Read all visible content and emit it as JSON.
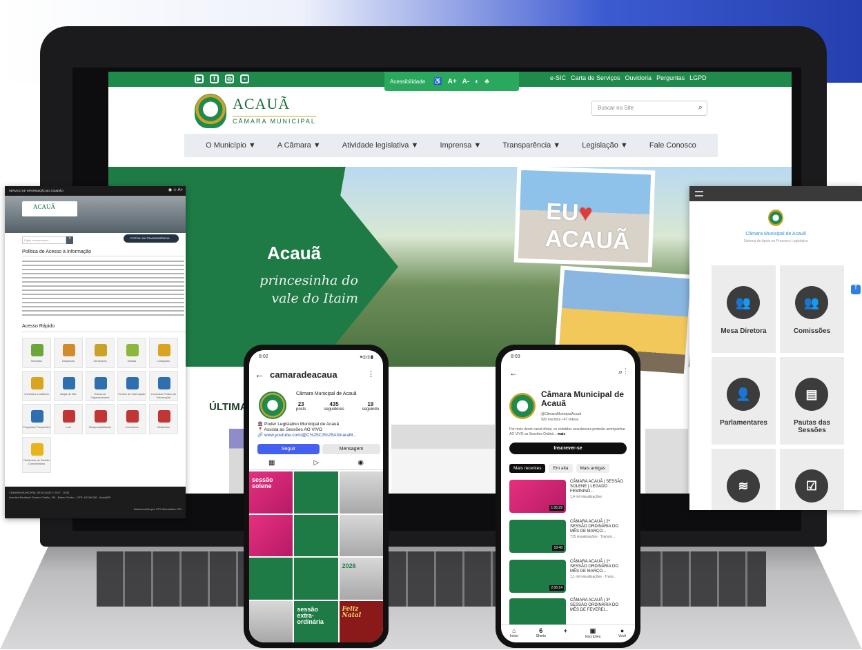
{
  "site": {
    "social": [
      "▶",
      "f",
      "◎",
      "▪"
    ],
    "accessibility_label": "Acessibilidade",
    "accessibility_icons": [
      "♿",
      "A+",
      "A-",
      "◐",
      "♣"
    ],
    "top_links": [
      "e-SIC",
      "Carta de Serviços",
      "Ouvidoria",
      "Perguntas",
      "LGPD"
    ],
    "logo_name": "ACAUÃ",
    "logo_sub": "CÂMARA MUNICIPAL",
    "search_placeholder": "Buscar no Site",
    "nav": [
      "O Município ▼",
      "A Câmara ▼",
      "Atividade legislativa ▼",
      "Imprensa ▼",
      "Transparência ▼",
      "Legislação ▼",
      "Fale Conosco"
    ],
    "hero_title": "Acauã",
    "hero_tagline_1": "princesinha do",
    "hero_tagline_2": "vale do Itaim",
    "hero_photo_text_1": "EU",
    "hero_photo_text_2": "♥",
    "hero_photo_text_3": "ACAUÃ",
    "section_title": "ÚLTIMA"
  },
  "left_portal": {
    "top_bar": "SERVIÇO DE INFORMAÇÃO AO CIDADÃO",
    "top_icons": "◉ ☆ A+",
    "logo": "ACAUÃ",
    "search_placeholder": "Digite sua pesquisa...",
    "portal_badge": "PORTAL DA TRANSPARÊNCIA",
    "heading": "Política de Acesso à Informação",
    "quick_access": "Acesso Rápido",
    "tiles": [
      "Receitas",
      "Despesas",
      "Servidores",
      "Diárias",
      "Licitações",
      "Contratos e Aditivos",
      "Mapa do Site",
      "Estrutura Organizacional",
      "Pedido de Informação",
      "Consultar Pedido de Informação",
      "Perguntas Frequentes",
      "Leis",
      "Responsabilidade",
      "Convênios",
      "Relatórios",
      "Relatórios de Gestão Consolidados"
    ],
    "footer_1": "CÂMARA MUNICIPAL DE ACAUÃ © 2017 - 2026",
    "footer_2": "Avenida Bonifácio Severo Coelho, 2M - Bairro Centro - CEP: 64748-000 - Acauã/PI",
    "footer_3": "Desenvolvido por STS Informática LTD"
  },
  "right_app": {
    "title": "Câmara Municipal de Acauã",
    "subtitle": "Sistema de Apoio ao Processo Legislativo",
    "cards": [
      "Mesa Diretora",
      "Comissões",
      "Parlamentares",
      "Pautas das Sessões",
      "",
      ""
    ],
    "badge": "T"
  },
  "instagram": {
    "time": "8:02",
    "status_icons": "▾◎◎▮",
    "username": "camaradeacaua",
    "display_name": "Câmara Municipal de Acauã",
    "posts": "23",
    "posts_label": "posts",
    "followers": "435",
    "followers_label": "seguidores",
    "following": "19",
    "following_label": "seguindo",
    "bio_1": "🏛 Poder Legislativo Municipal de Acauã",
    "bio_2": "📍 Assista as Sessões AO VIVO",
    "bio_link": "🔗 www.youtube.com/@C%25C3%25A3maraM...",
    "follow_btn": "Seguir",
    "message_btn": "Mensagem",
    "tabs": [
      "▦",
      "▷",
      "◉"
    ],
    "grid_labels": [
      "sessão solene",
      "",
      "",
      "",
      "",
      "",
      "",
      "",
      "2026",
      "",
      "sessão extra-ordinária",
      "Feliz Natal"
    ]
  },
  "youtube": {
    "time": "8:03",
    "channel": "Câmara Municipal de Acauã",
    "handle": "@CâmaraMunicipalAcauã",
    "meta": "920 inscritos • 47 vídeos",
    "desc_1": "Por meio deste canal oficial, os cidadãos acauãenses",
    "desc_2": "poderão acompanhar AO VIVO as Sessões Ordiná...",
    "desc_more": "mais",
    "subscribe": "Inscrever-se",
    "chips": [
      "Mais recentes",
      "Em alta",
      "Mais antigas"
    ],
    "videos": [
      {
        "title": "CÂMARA ACAUÃ | SESSÃO SOLENE | LEGADO FEMININO...",
        "views": "1,4 mil visualizações",
        "dur": "1:05:29"
      },
      {
        "title": "CÂMARA ACAUÃ | 2ª SESSÃO ORDINÁRIA DO MÊS DE MARÇO...",
        "views": "715 visualizações · Transm...",
        "dur": "18:48"
      },
      {
        "title": "CÂMARA ACAUÃ | 1ª SESSÃO ORDINÁRIA DO MÊS DE MARÇO...",
        "views": "1,1 mil visualizações · Trans...",
        "dur": "2:06:14"
      },
      {
        "title": "CÂMARA ACAUÃ | 3ª SESSÃO ORDINÁRIA DO MÊS DE FEVEREI...",
        "views": "",
        "dur": ""
      }
    ],
    "nav": [
      "Início",
      "Shorts",
      "+",
      "Inscrições",
      "Você"
    ]
  }
}
